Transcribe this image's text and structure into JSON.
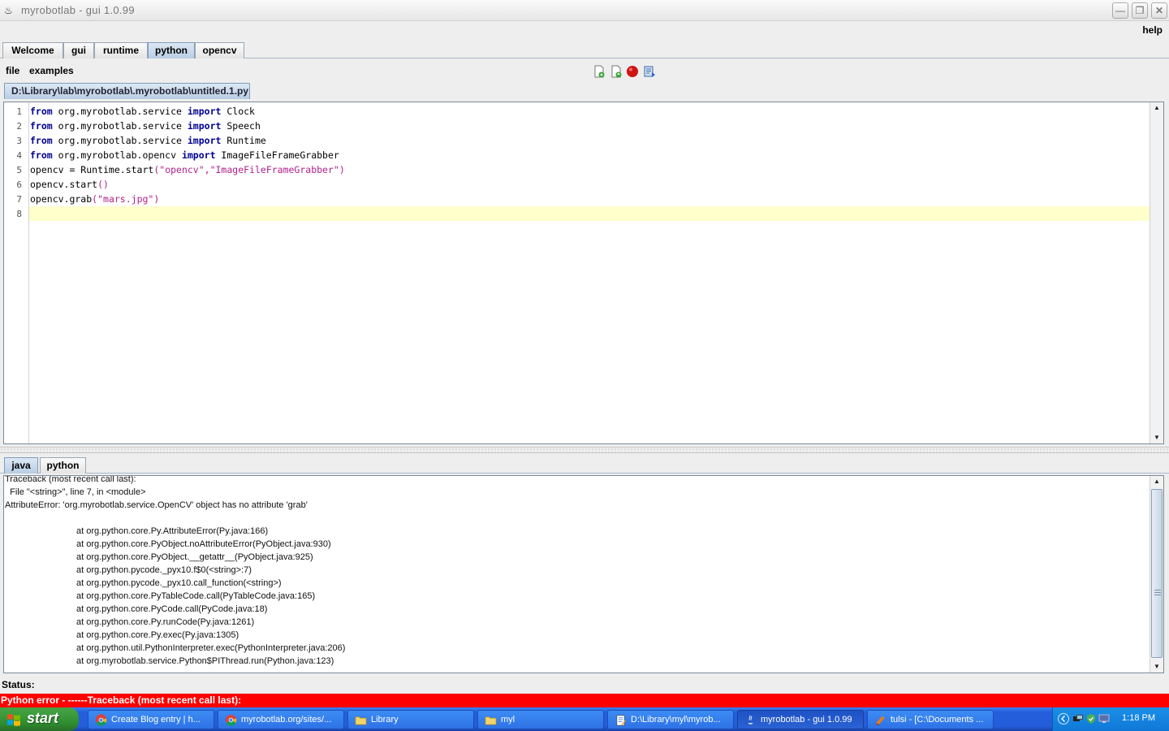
{
  "window": {
    "title": "myrobotlab - gui 1.0.99"
  },
  "menubar": {
    "help": "help"
  },
  "tabs": [
    "Welcome",
    "gui",
    "runtime",
    "python",
    "opencv"
  ],
  "script_menu": {
    "file": "file",
    "examples": "examples"
  },
  "file_tab": "D:\\Library\\lab\\myrobotlab\\.myrobotlab\\untitled.1.py",
  "editor": {
    "line_numbers": [
      "1",
      "2",
      "3",
      "4",
      "5",
      "6",
      "7",
      "8"
    ],
    "lines": [
      [
        "from",
        " org.myrobotlab.service ",
        "import",
        " Clock"
      ],
      [
        "from",
        " org.myrobotlab.service ",
        "import",
        " Speech"
      ],
      [
        "from",
        " org.myrobotlab.service ",
        "import",
        " Runtime"
      ],
      [
        "from",
        " org.myrobotlab.opencv ",
        "import",
        " ImageFileFrameGrabber"
      ],
      [
        "opencv = Runtime.start",
        "(",
        "\"opencv\",\"ImageFileFrameGrabber\"",
        ")"
      ],
      [
        "opencv.start",
        "()",
        "",
        ""
      ],
      [
        "opencv.grab",
        "(",
        "\"mars.jpg\"",
        ")"
      ],
      [
        "",
        "",
        "",
        ""
      ]
    ]
  },
  "console_tabs": [
    "java",
    "python"
  ],
  "console": {
    "head": [
      "Traceback (most recent call last):",
      "  File \"<string>\", line 7, in <module>",
      "AttributeError: 'org.myrobotlab.service.OpenCV' object has no attribute 'grab'"
    ],
    "stack": [
      "at org.python.core.Py.AttributeError(Py.java:166)",
      "at org.python.core.PyObject.noAttributeError(PyObject.java:930)",
      "at org.python.core.PyObject.__getattr__(PyObject.java:925)",
      "at org.python.pycode._pyx10.f$0(<string>:7)",
      "at org.python.pycode._pyx10.call_function(<string>)",
      "at org.python.core.PyTableCode.call(PyTableCode.java:165)",
      "at org.python.core.PyCode.call(PyCode.java:18)",
      "at org.python.core.Py.runCode(Py.java:1261)",
      "at org.python.core.Py.exec(Py.java:1305)",
      "at org.python.util.PythonInterpreter.exec(PythonInterpreter.java:206)",
      "at org.myrobotlab.service.Python$PIThread.run(Python.java:123)"
    ]
  },
  "status": {
    "label": "Status:",
    "error": "Python error - ------Traceback (most recent call last):"
  },
  "taskbar": {
    "start": "start",
    "tasks": [
      {
        "label": "Create Blog entry | h...",
        "icon": "chrome-icon"
      },
      {
        "label": "myrobotlab.org/sites/...",
        "icon": "chrome-icon"
      },
      {
        "label": "Library",
        "icon": "folder-icon"
      },
      {
        "label": "myl",
        "icon": "folder-icon"
      },
      {
        "label": "D:\\Library\\myl\\myrob...",
        "icon": "notepad-icon"
      },
      {
        "label": "myrobotlab - gui 1.0.99",
        "icon": "java-icon"
      },
      {
        "label": "tulsi - [C:\\Documents ...",
        "icon": "app-icon"
      }
    ],
    "clock": "1:18 PM"
  },
  "colors": {
    "error_bar": "#ff0000",
    "keyword": "#000090",
    "string": "#b0208a",
    "current_line": "#ffffcc",
    "taskbar": "#245edb",
    "start_button": "#3c9c3c"
  }
}
